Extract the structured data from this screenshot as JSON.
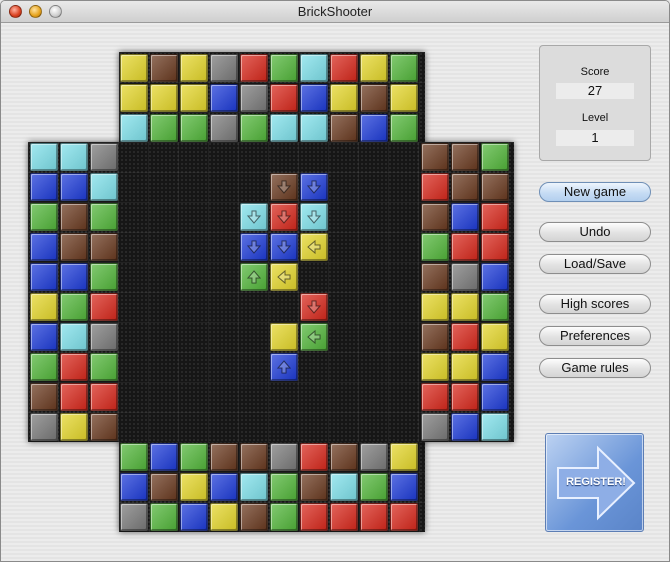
{
  "window": {
    "title": "BrickShooter"
  },
  "score_panel": {
    "score_label": "Score",
    "score_value": "27",
    "level_label": "Level",
    "level_value": "1"
  },
  "buttons": {
    "new_game": "New game",
    "undo": "Undo",
    "load_save": "Load/Save",
    "high_scores": "High scores",
    "preferences": "Preferences",
    "game_rules": "Game rules"
  },
  "register": {
    "label": "REGISTER!"
  },
  "colors": {
    "Y": "#e4d62a",
    "B": "#6a3a20",
    "G": "#52b63a",
    "K": "#7a7a7a",
    "R": "#d8281c",
    "C": "#7ee0ea",
    "U": "#1d3bd8"
  },
  "board": {
    "top_rows": [
      [
        "Y",
        "B",
        "Y",
        "K",
        "R",
        "G",
        "C",
        "R",
        "Y",
        "G"
      ],
      [
        "Y",
        "Y",
        "Y",
        "U",
        "K",
        "R",
        "U",
        "Y",
        "B",
        "Y"
      ],
      [
        "C",
        "G",
        "G",
        "K",
        "G",
        "C",
        "C",
        "B",
        "U",
        "G"
      ]
    ],
    "bottom_rows": [
      [
        "G",
        "U",
        "G",
        "B",
        "B",
        "K",
        "R",
        "B",
        "K",
        "Y"
      ],
      [
        "U",
        "B",
        "Y",
        "U",
        "C",
        "G",
        "B",
        "C",
        "G",
        "U"
      ],
      [
        "K",
        "G",
        "U",
        "Y",
        "B",
        "G",
        "R",
        "R",
        "R",
        "R"
      ]
    ],
    "left_rows": [
      [
        "C",
        "C",
        "K"
      ],
      [
        "U",
        "U",
        "C"
      ],
      [
        "G",
        "B",
        "G"
      ],
      [
        "U",
        "B",
        "B"
      ],
      [
        "U",
        "U",
        "G"
      ],
      [
        "Y",
        "G",
        "R"
      ],
      [
        "U",
        "C",
        "K"
      ],
      [
        "G",
        "R",
        "G"
      ],
      [
        "B",
        "R",
        "R"
      ],
      [
        "K",
        "Y",
        "B"
      ]
    ],
    "right_rows": [
      [
        "B",
        "B",
        "G"
      ],
      [
        "R",
        "B",
        "B"
      ],
      [
        "B",
        "U",
        "R"
      ],
      [
        "G",
        "R",
        "R"
      ],
      [
        "B",
        "K",
        "U"
      ],
      [
        "Y",
        "Y",
        "G"
      ],
      [
        "B",
        "R",
        "Y"
      ],
      [
        "Y",
        "Y",
        "U"
      ],
      [
        "R",
        "R",
        "U"
      ],
      [
        "K",
        "U",
        "C"
      ]
    ],
    "field_bricks": [
      {
        "row": 1,
        "col": 5,
        "color": "B",
        "arrow": "down"
      },
      {
        "row": 1,
        "col": 6,
        "color": "U",
        "arrow": "down"
      },
      {
        "row": 2,
        "col": 4,
        "color": "C",
        "arrow": "down"
      },
      {
        "row": 2,
        "col": 5,
        "color": "R",
        "arrow": "down"
      },
      {
        "row": 2,
        "col": 6,
        "color": "C",
        "arrow": "down"
      },
      {
        "row": 3,
        "col": 4,
        "color": "U",
        "arrow": "down"
      },
      {
        "row": 3,
        "col": 5,
        "color": "U",
        "arrow": "down"
      },
      {
        "row": 3,
        "col": 6,
        "color": "Y",
        "arrow": "left"
      },
      {
        "row": 4,
        "col": 4,
        "color": "G",
        "arrow": "up"
      },
      {
        "row": 4,
        "col": 5,
        "color": "Y",
        "arrow": "left"
      },
      {
        "row": 5,
        "col": 6,
        "color": "R",
        "arrow": "down"
      },
      {
        "row": 6,
        "col": 5,
        "color": "Y",
        "arrow": "none"
      },
      {
        "row": 6,
        "col": 6,
        "color": "G",
        "arrow": "left"
      },
      {
        "row": 7,
        "col": 5,
        "color": "U",
        "arrow": "up"
      }
    ]
  }
}
